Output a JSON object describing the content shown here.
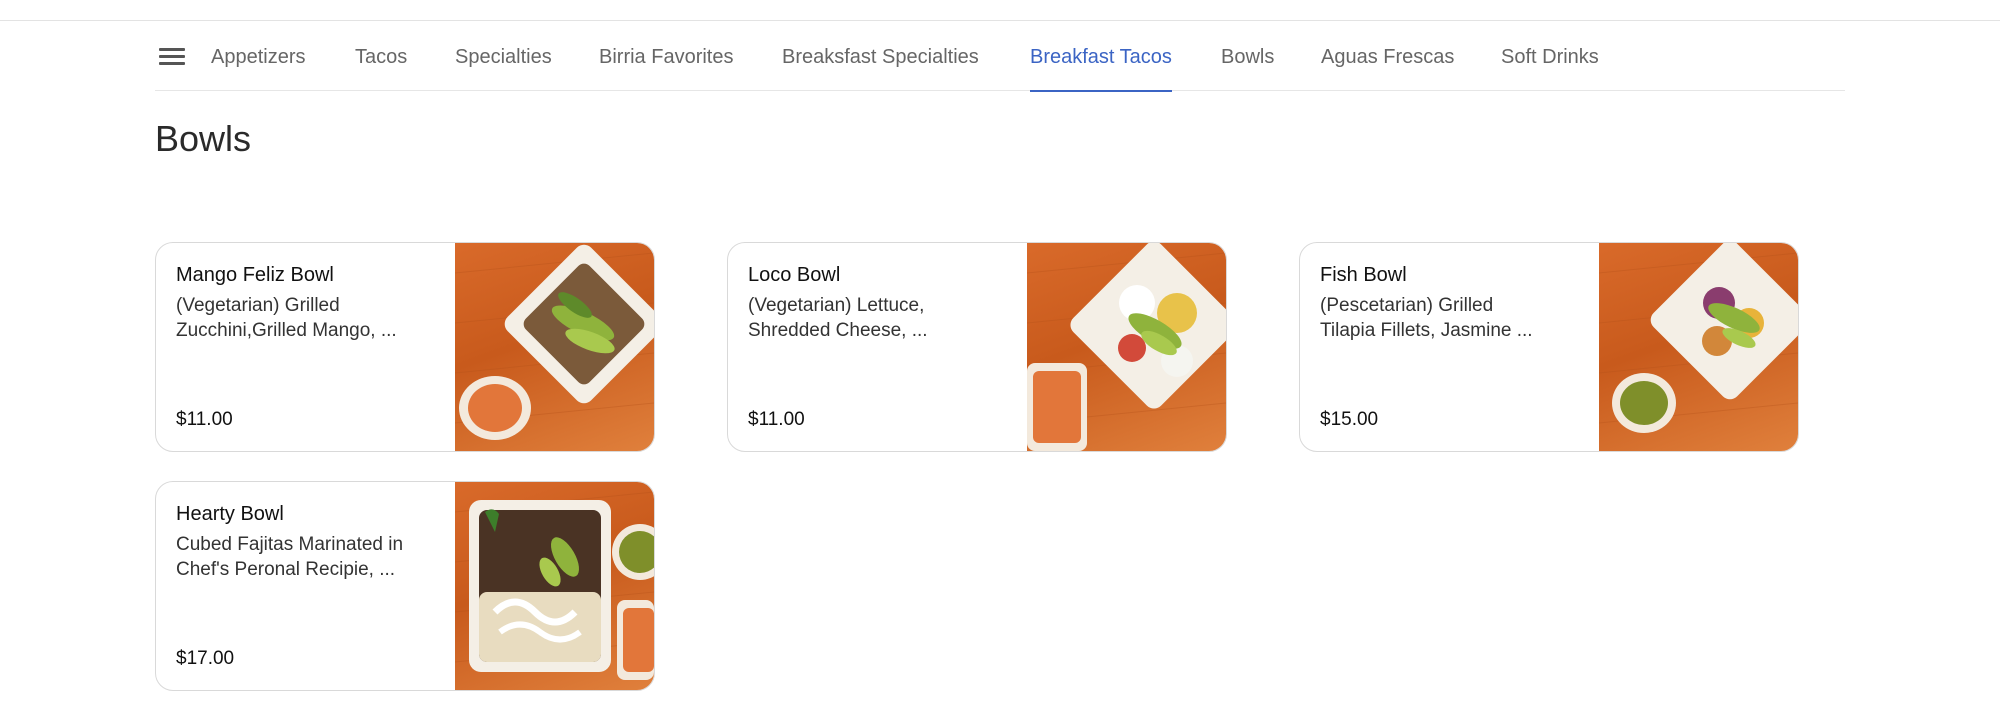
{
  "nav": {
    "menu_icon": "hamburger-menu-icon",
    "active_index": 5,
    "tabs": [
      {
        "label": "Appetizers"
      },
      {
        "label": "Tacos"
      },
      {
        "label": "Specialties"
      },
      {
        "label": "Birria Favorites"
      },
      {
        "label": "Breaksfast Specialties"
      },
      {
        "label": "Breakfast Tacos"
      },
      {
        "label": "Bowls"
      },
      {
        "label": "Aguas Frescas"
      },
      {
        "label": "Soft Drinks"
      }
    ]
  },
  "section": {
    "title": "Bowls"
  },
  "items": [
    {
      "name": "Mango Feliz Bowl",
      "description": "(Vegetarian) Grilled\nZucchini,Grilled Mango, ...",
      "price": "$11.00",
      "image": "bowl-photo"
    },
    {
      "name": "Loco Bowl",
      "description": "(Vegetarian) Lettuce,\nShredded Cheese, ...",
      "price": "$11.00",
      "image": "bowl-photo"
    },
    {
      "name": "Fish Bowl",
      "description": "(Pescetarian) Grilled\nTilapia Fillets, Jasmine ...",
      "price": "$15.00",
      "image": "bowl-photo"
    },
    {
      "name": "Hearty Bowl",
      "description": "Cubed Fajitas Marinated in\nChef's Peronal  Recipie, ...",
      "price": "$17.00",
      "image": "bowl-photo"
    }
  ],
  "colors": {
    "accent": "#3b64c4",
    "tab_text": "#666666",
    "card_border": "#d9d9d9"
  }
}
